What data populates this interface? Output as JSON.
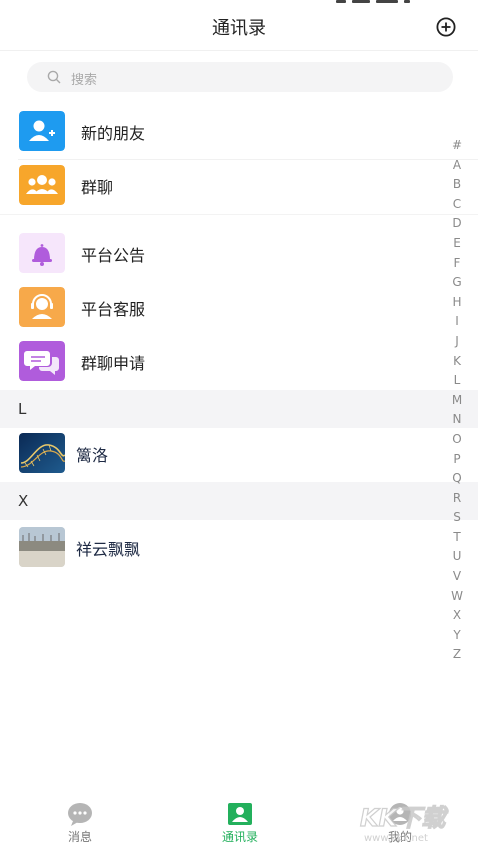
{
  "header": {
    "title": "通讯录"
  },
  "search": {
    "placeholder": "搜索"
  },
  "functions": [
    {
      "label": "新的朋友",
      "icon": "add-user-icon",
      "color": "#1e9bf0"
    },
    {
      "label": "群聊",
      "icon": "group-icon",
      "color": "#f7a62b"
    }
  ],
  "services": [
    {
      "label": "平台公告",
      "icon": "bell-icon",
      "color": "#f6e6fb"
    },
    {
      "label": "平台客服",
      "icon": "headset-agent-icon",
      "color": "#f7a94a"
    },
    {
      "label": "群聊申请",
      "icon": "chat-bubbles-icon",
      "color": "#b05cdc"
    }
  ],
  "sections": [
    {
      "letter": "L",
      "contacts": [
        {
          "name": "篱洛"
        }
      ]
    },
    {
      "letter": "X",
      "contacts": [
        {
          "name": "祥云飘飘"
        }
      ]
    }
  ],
  "index": [
    "#",
    "A",
    "B",
    "C",
    "D",
    "E",
    "F",
    "G",
    "H",
    "I",
    "J",
    "K",
    "L",
    "M",
    "N",
    "O",
    "P",
    "Q",
    "R",
    "S",
    "T",
    "U",
    "V",
    "W",
    "X",
    "Y",
    "Z"
  ],
  "tabs": [
    {
      "label": "消息",
      "icon": "chat-icon",
      "active": false
    },
    {
      "label": "通讯录",
      "icon": "contacts-icon",
      "active": true
    },
    {
      "label": "我的",
      "icon": "profile-icon",
      "active": false
    }
  ],
  "watermark": {
    "text": "KK下载",
    "site": "www.kkx.net"
  },
  "colors": {
    "accent": "#23b05c",
    "section_bg": "#f4f4f6"
  }
}
